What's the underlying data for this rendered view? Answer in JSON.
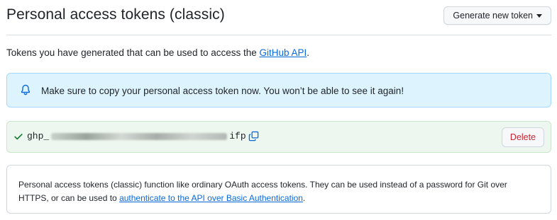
{
  "header": {
    "title": "Personal access tokens (classic)",
    "generate_button_label": "Generate new token"
  },
  "intro": {
    "text_before": "Tokens you have generated that can be used to access the ",
    "link_text": "GitHub API",
    "text_after": "."
  },
  "flash": {
    "icon": "bell-icon",
    "message": "Make sure to copy your personal access token now. You won’t be able to see it again!"
  },
  "token": {
    "prefix": "ghp_",
    "suffix": "ifp",
    "delete_label": "Delete"
  },
  "info": {
    "text_before": "Personal access tokens (classic) function like ordinary OAuth access tokens. They can be used instead of a password for Git over HTTPS, or can be used to ",
    "link_text": "authenticate to the API over Basic Authentication",
    "text_after": "."
  },
  "colors": {
    "link": "#0969da",
    "flash_bg": "#ddf4ff",
    "token_bg": "#eef7ef",
    "danger": "#cf222e",
    "success": "#1a7f37"
  }
}
